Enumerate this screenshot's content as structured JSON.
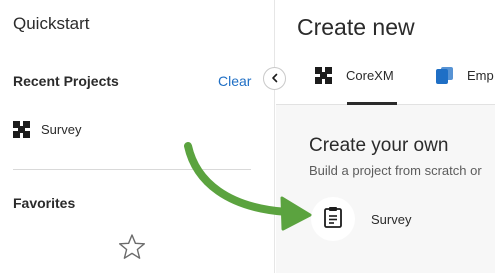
{
  "sidebar": {
    "title": "Quickstart",
    "recent_heading": "Recent Projects",
    "clear_label": "Clear",
    "recent_projects": [
      {
        "label": "Survey",
        "icon": "corexm-icon"
      }
    ],
    "favorites_heading": "Favorites",
    "favorites_empty_icon": "star-outline-icon"
  },
  "main": {
    "title": "Create new",
    "tabs": [
      {
        "label": "CoreXM",
        "icon": "corexm-icon",
        "selected": true
      },
      {
        "label": "Emp",
        "icon": "employee-xm-icon",
        "selected": false
      }
    ],
    "create_own": {
      "title": "Create your own",
      "subtitle": "Build a project from scratch or",
      "option_label": "Survey",
      "option_icon": "clipboard-icon"
    }
  },
  "colors": {
    "link": "#1f6fc5",
    "annotation_arrow": "#5ba33f",
    "employee_icon": "#1f6fc5",
    "main_background": "#f7f7f7"
  },
  "annotation": {
    "icon": "green-arrow-pointing-to-survey"
  }
}
